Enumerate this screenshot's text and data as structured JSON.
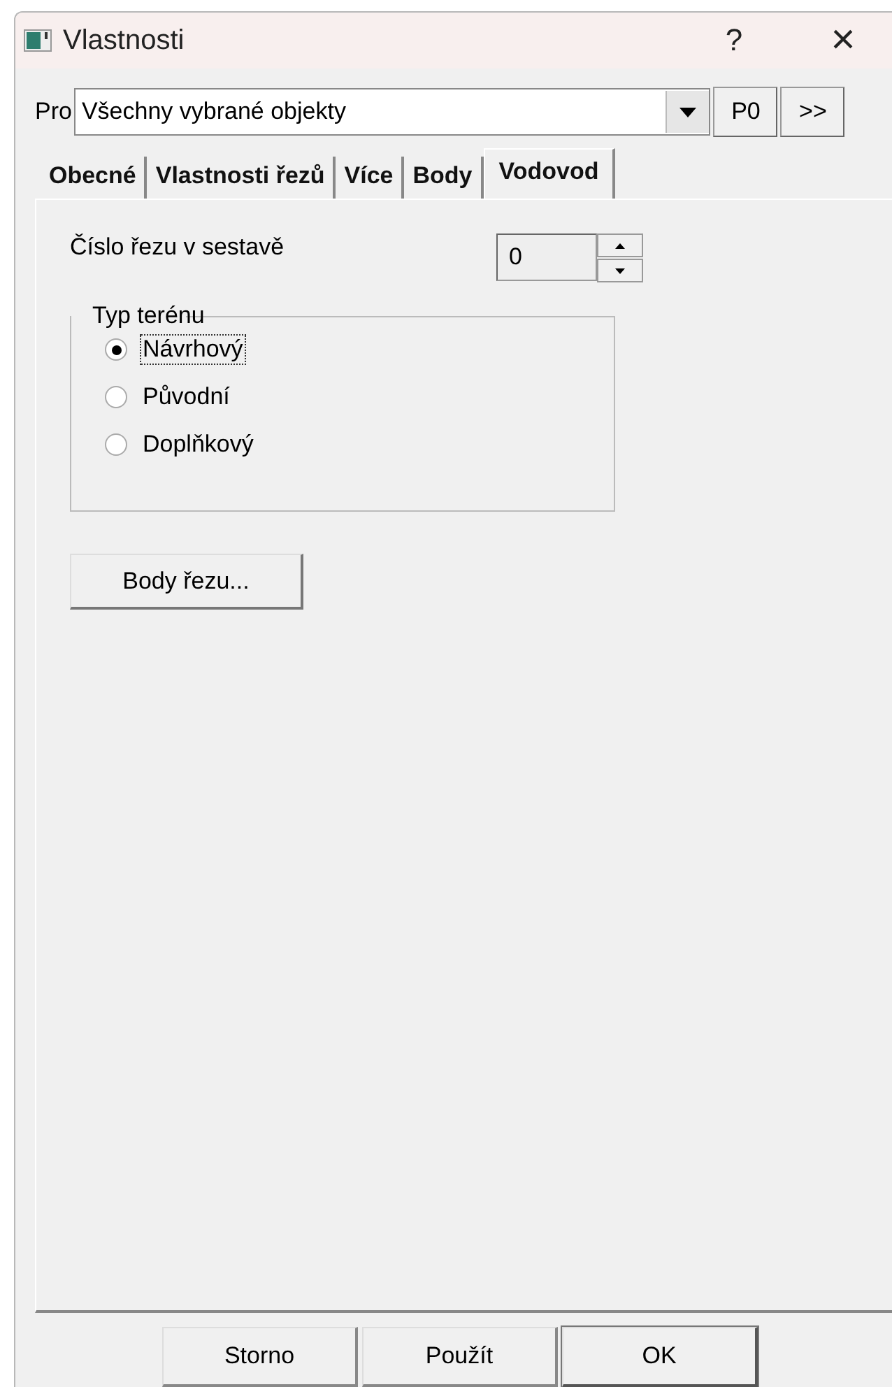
{
  "window": {
    "title": "Vlastnosti",
    "help": "?",
    "close": "×"
  },
  "target": {
    "label": "Pro",
    "value": "Všechny vybrané objekty",
    "buttons": [
      "P0",
      ">>"
    ]
  },
  "tabs": [
    {
      "label": "Obecné",
      "selected": false
    },
    {
      "label": "Vlastnosti řezů",
      "selected": false
    },
    {
      "label": "Více",
      "selected": false
    },
    {
      "label": "Body",
      "selected": false
    },
    {
      "label": "Vodovod",
      "selected": true
    }
  ],
  "section_number": {
    "label": "Číslo řezu v sestavě",
    "value": "0"
  },
  "terrain_type": {
    "title": "Typ terénu",
    "options": [
      {
        "label": "Návrhový",
        "selected": true,
        "focused": true
      },
      {
        "label": "Původní",
        "selected": false,
        "focused": false
      },
      {
        "label": "Doplňkový",
        "selected": false,
        "focused": false
      }
    ]
  },
  "points_button": "Body řezu...",
  "buttons": [
    {
      "label": "Storno",
      "default": false
    },
    {
      "label": "Použít",
      "default": false
    },
    {
      "label": "OK",
      "default": true
    }
  ]
}
